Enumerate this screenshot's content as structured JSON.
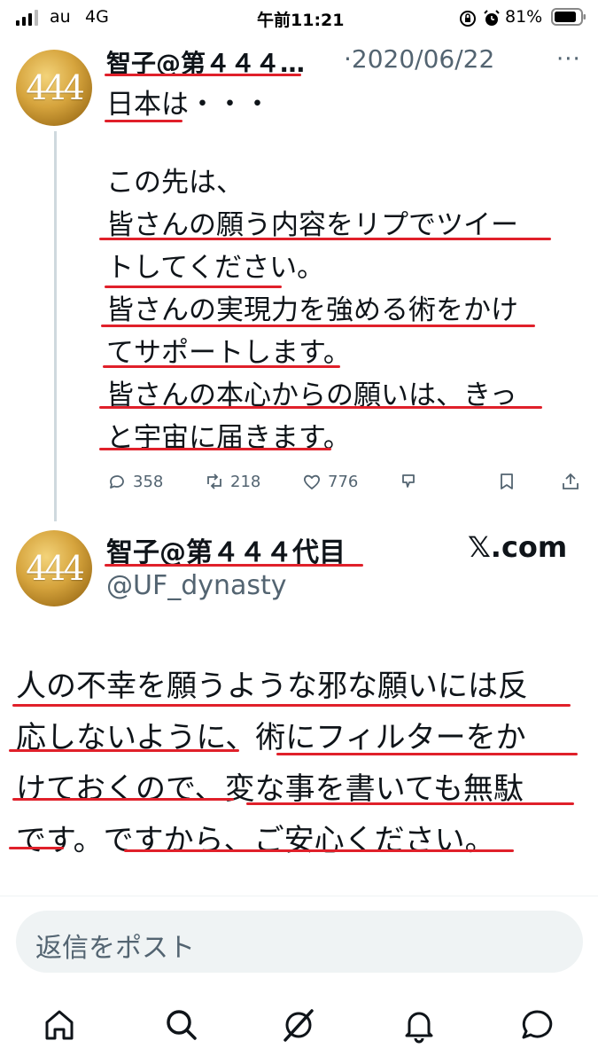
{
  "status_bar": {
    "carrier": "au",
    "network": "4G",
    "time": "午前11:21",
    "battery": "81%"
  },
  "tweet1": {
    "author": "智子@第４４４…",
    "date": "·2020/06/22",
    "avatar_text": "444",
    "lines": [
      "日本は・・・",
      "",
      "この先は、",
      "皆さんの願う内容をリプでツイー",
      "トしてください。",
      "皆さんの実現力を強める術をかけ",
      "てサポートします。",
      "皆さんの本心からの願いは、きっ",
      "と宇宙に届きます。"
    ],
    "replies": "358",
    "reposts": "218",
    "likes": "776"
  },
  "tweet2": {
    "author": "智子@第４４４代目",
    "handle": "@UF_dynasty",
    "avatar_text": "444",
    "brand": "𝕏.com",
    "lines": [
      "人の不幸を願うような邪な願いには反",
      "応しないように、術にフィルターをか",
      "けておくので、変な事を書いても無駄",
      "です。ですから、ご安心ください。"
    ]
  },
  "reply_box": {
    "placeholder": "返信をポスト"
  },
  "bottom_nav": [
    "home-icon",
    "search-icon",
    "grok-icon",
    "notifications-icon",
    "messages-icon"
  ],
  "colors": {
    "underline": "#e0202a",
    "muted": "#536471",
    "thread_line": "#cfd9de"
  }
}
